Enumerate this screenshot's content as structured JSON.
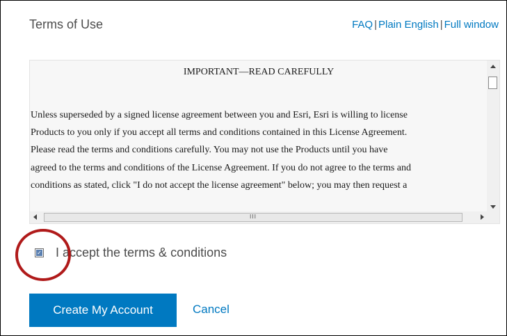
{
  "header": {
    "title": "Terms of Use",
    "links": {
      "faq": "FAQ",
      "plain_english": "Plain English",
      "full_window": "Full window",
      "separator": "|"
    }
  },
  "terms": {
    "heading": "IMPORTANT—READ CAREFULLY",
    "lines": [
      "Unless superseded by a signed license agreement between you and Esri, Esri is willing to license",
      "Products to you only if you accept all terms and conditions contained in this License Agreement.",
      "Please read the terms and conditions carefully. You may not use the Products until you have",
      "agreed to the terms and conditions of the License Agreement. If you do not agree to the terms and",
      "conditions as stated, click \"I do not accept the license agreement\" below; you may then request a"
    ],
    "scroll_thumb_grip": "III"
  },
  "accept": {
    "label": "I accept the terms & conditions",
    "checked": true,
    "check_glyph": "✓"
  },
  "actions": {
    "create_label": "Create My Account",
    "cancel_label": "Cancel"
  },
  "colors": {
    "accent": "#0079c1",
    "annotation_circle": "#b01a1a"
  }
}
